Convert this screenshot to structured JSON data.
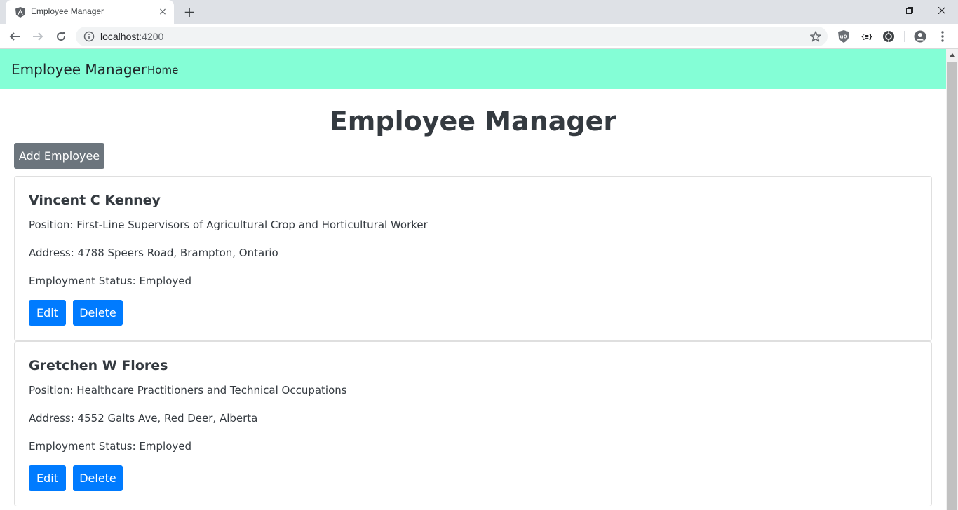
{
  "browser": {
    "tab": {
      "title": "Employee Manager",
      "favicon": "angular-icon",
      "close": "×"
    },
    "new_tab": "+",
    "address": {
      "host": "localhost",
      "port": ":4200"
    },
    "window_controls": [
      "minimize-icon",
      "restore-icon",
      "close-icon"
    ],
    "extensions": [
      "ublock-icon",
      "json-viewer-icon",
      "extension-icon"
    ]
  },
  "app": {
    "brand": "Employee Manager",
    "nav": [
      {
        "label": "Home"
      }
    ],
    "page_title": "Employee Manager",
    "add_button": "Add Employee",
    "employees": [
      {
        "name": "Vincent C Kenney",
        "position": "Position: First-Line Supervisors of Agricultural Crop and Horticultural Worker",
        "address": "Address: 4788 Speers Road, Brampton, Ontario",
        "status": "Employment Status: Employed",
        "edit_label": "Edit",
        "delete_label": "Delete"
      },
      {
        "name": "Gretchen W Flores",
        "position": "Position: Healthcare Practitioners and Technical Occupations",
        "address": "Address: 4552 Galts Ave, Red Deer, Alberta",
        "status": "Employment Status: Employed",
        "edit_label": "Edit",
        "delete_label": "Delete"
      }
    ]
  },
  "colors": {
    "navbar": "#84fed6",
    "primary": "#007bff",
    "secondary": "#6c757d"
  }
}
